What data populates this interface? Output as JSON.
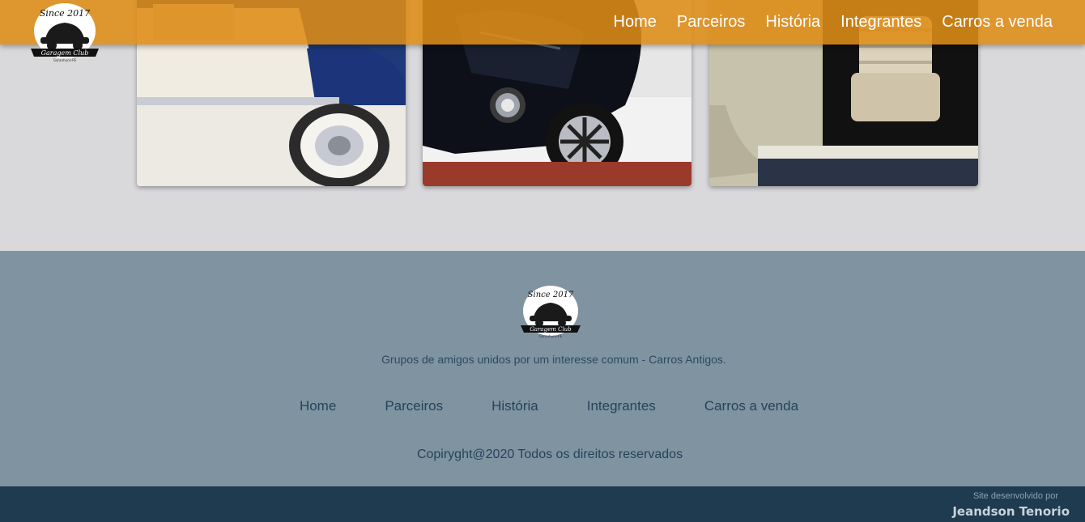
{
  "header": {
    "logo": {
      "top_text": "Since 2017",
      "banner_text": "Garagem Club",
      "sub_text": "Garanhuns-PE"
    },
    "nav": [
      "Home",
      "Parceiros",
      "História",
      "Integrantes",
      "Carros a venda"
    ]
  },
  "gallery": {
    "cards": [
      {
        "subject": "blue and white beetle with whitewall tire"
      },
      {
        "subject": "black beetle front with chrome wheel"
      },
      {
        "subject": "beetle beige interior seats"
      }
    ]
  },
  "footer": {
    "tagline": "Grupos de amigos unidos por um interesse comum - Carros Antigos.",
    "nav": [
      "Home",
      "Parceiros",
      "História",
      "Integrantes",
      "Carros a venda"
    ],
    "copyright": "Copiryght@2020 Todos os direitos reservados"
  },
  "bottombar": {
    "dev_label": "Site desenvolvido por",
    "dev_name": "Jeandson Tenorio"
  },
  "colors": {
    "header_bg": "#de8c16",
    "page_bg": "#d9d9dc",
    "footer_bg": "#8093a1",
    "bottombar_bg": "#1e3b50",
    "footer_text": "#24435c"
  }
}
